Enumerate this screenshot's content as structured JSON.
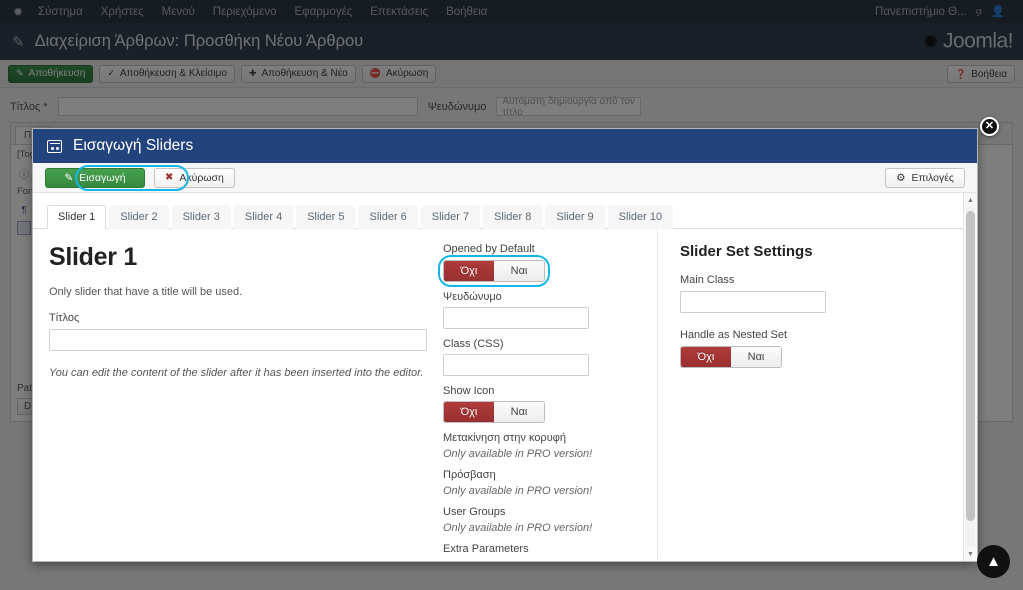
{
  "admin": {
    "topnav": {
      "brand_icon": "joomla-mark-icon",
      "items": [
        {
          "label": "Σύστημα"
        },
        {
          "label": "Χρήστες"
        },
        {
          "label": "Μενού"
        },
        {
          "label": "Περιεχόμενο"
        },
        {
          "label": "Εφαρμογές"
        },
        {
          "label": "Επεκτάσεις"
        },
        {
          "label": "Βοήθεια"
        }
      ],
      "site_name": "Πανεπιστήμιο Θ...",
      "external_icon": "external-link-icon",
      "user_icon": "user-icon"
    },
    "subheader": {
      "pencil_icon": "pencil-icon",
      "page_title": "Διαχείριση Άρθρων: Προσθήκη Νέου Άρθρου",
      "logo_word": "Joomla!"
    },
    "toolbar": {
      "save": "Αποθήκευση",
      "save_close": "Αποθήκευση & Κλείσιμο",
      "save_new": "Αποθήκευση & Νέο",
      "cancel": "Ακύρωση",
      "help": "Βοήθεια"
    },
    "title_field": {
      "label": "Τίτλος *",
      "value": "",
      "placeholder": ""
    },
    "alias_field": {
      "label": "Ψευδώνυμο",
      "value": "",
      "placeholder": "Αυτόματη δημιουργία από τον τίτλο"
    },
    "editor": {
      "tab_label": "Π...",
      "toggle_label": "[Toggle Editor]",
      "font_label": "Font...",
      "path_label": "Path:",
      "path_button": "D...",
      "icons": [
        "info-icon",
        "paragraph-icon",
        "grid-icon"
      ]
    }
  },
  "modal": {
    "header": {
      "icon": "window-insert-icon",
      "title": "Εισαγωγή Sliders"
    },
    "toolbar": {
      "import": "Εισαγωγή",
      "import_icon": "edit-icon",
      "cancel": "Ακύρωση",
      "cancel_icon": "cancel-circle-icon",
      "options": "Επιλογές",
      "options_icon": "gear-icon"
    },
    "tabs": [
      {
        "label": "Slider 1",
        "active": true
      },
      {
        "label": "Slider 2",
        "active": false
      },
      {
        "label": "Slider 3",
        "active": false
      },
      {
        "label": "Slider 4",
        "active": false
      },
      {
        "label": "Slider 5",
        "active": false
      },
      {
        "label": "Slider 6",
        "active": false
      },
      {
        "label": "Slider 7",
        "active": false
      },
      {
        "label": "Slider 8",
        "active": false
      },
      {
        "label": "Slider 9",
        "active": false
      },
      {
        "label": "Slider 10",
        "active": false
      }
    ],
    "left": {
      "heading": "Slider 1",
      "note": "Only slider that have a title will be used.",
      "title_label": "Τίτλος",
      "title_value": "",
      "footnote": "You can edit the content of the slider after it has been inserted into the editor."
    },
    "middle": {
      "opened_label": "Opened by Default",
      "opened_no": "Όχι",
      "opened_yes": "Ναι",
      "opened_selected": "Όχι",
      "alias_label": "Ψευδώνυμο",
      "alias_value": "",
      "class_label": "Class (CSS)",
      "class_value": "",
      "showicon_label": "Show Icon",
      "showicon_no": "Όχι",
      "showicon_yes": "Ναι",
      "showicon_selected": "Όχι",
      "movetop_label": "Μετακίνηση στην κορυφή",
      "movetop_value": "Only available in PRO version!",
      "access_label": "Πρόσβαση",
      "access_value": "Only available in PRO version!",
      "usergroups_label": "User Groups",
      "usergroups_value": "Only available in PRO version!",
      "extra_label": "Extra Parameters"
    },
    "right": {
      "heading": "Slider Set Settings",
      "mainclass_label": "Main Class",
      "mainclass_value": "",
      "nested_label": "Handle as Nested Set",
      "nested_no": "Όχι",
      "nested_yes": "Ναι",
      "nested_selected": "Όχι"
    }
  },
  "controls": {
    "close_icon": "close-icon",
    "close_glyph": "✕",
    "back_to_top_icon": "chevron-up-icon",
    "back_to_top_glyph": "︿"
  },
  "colors": {
    "nav_dark": "#1c2733",
    "subhead_dark": "#22303f",
    "modal_header_blue": "#22437c",
    "toggle_red": "#a8332f",
    "green_button": "#36893f",
    "highlight_cyan": "#12b6e8"
  }
}
